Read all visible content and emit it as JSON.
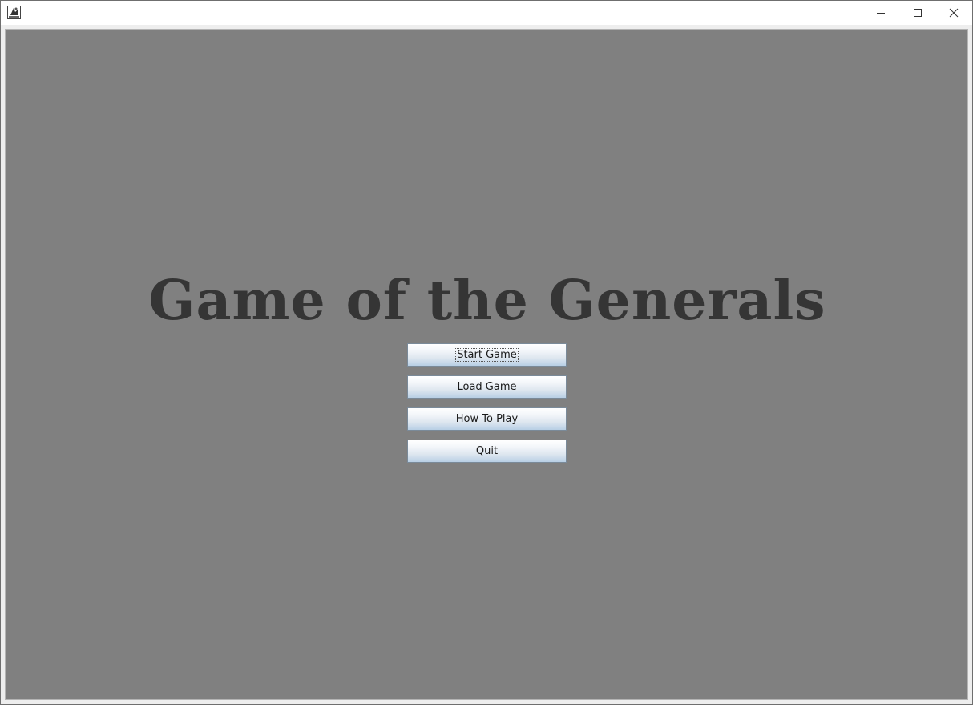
{
  "window": {
    "icon": "java-app-icon",
    "controls": {
      "minimize_icon": "minimize-icon",
      "maximize_icon": "maximize-icon",
      "close_icon": "close-icon"
    }
  },
  "main": {
    "title": "Game of the Generals",
    "buttons": [
      {
        "label": "Start Game",
        "focused": true
      },
      {
        "label": "Load Game"
      },
      {
        "label": "How To Play"
      },
      {
        "label": "Quit"
      }
    ]
  },
  "colors": {
    "background": "#808080",
    "title_text": "#353535",
    "button_gradient_bottom": "#b8cfe5"
  }
}
